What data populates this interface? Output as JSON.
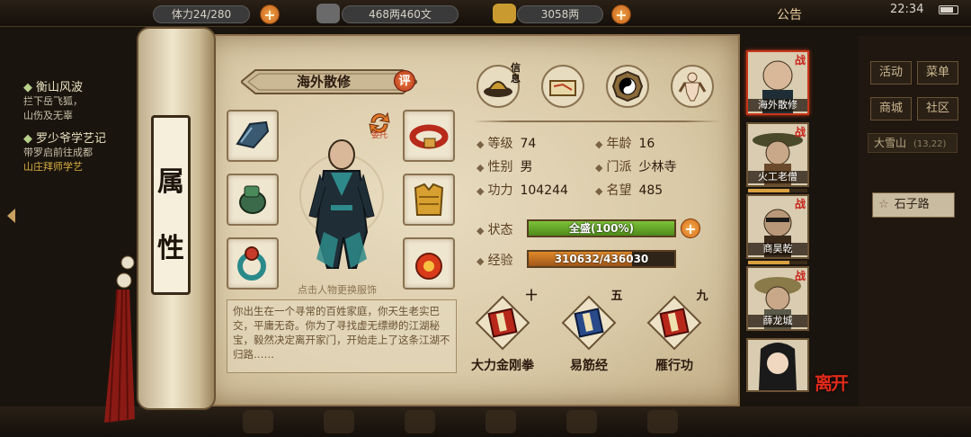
{
  "topbar": {
    "stamina": "体力24/280",
    "money": "468两460文",
    "gold": "3058两",
    "notice": "公告",
    "clock": "22:34"
  },
  "quests": [
    {
      "title": "衡山风波",
      "lines": [
        "拦下岳飞狐，",
        "山伤及无辜"
      ]
    },
    {
      "title": "罗少爷学艺记",
      "lines": [
        "带罗启前往成都",
        "山庄拜师学艺"
      ]
    }
  ],
  "side_menu": {
    "buttons": [
      "活动",
      "菜单",
      "商城",
      "社区"
    ],
    "region": "大雪山",
    "region_coords": "(13,22)",
    "location": "石子路"
  },
  "scroll": {
    "title_chars": [
      "属",
      "性"
    ],
    "name": "海外散修",
    "eval": "评",
    "delegate": "委托",
    "hero_hint": "点击人物更换服饰",
    "bio": "你出生在一个寻常的百姓家庭，你天生老实巴交，平庸无奇。你为了寻找虚无缥缈的江湖秘宝，毅然决定离开家门，开始走上了这条江湖不归路……",
    "info_tag": "信息"
  },
  "stats": {
    "level_label": "等级",
    "level": "74",
    "age_label": "年龄",
    "age": "16",
    "gender_label": "性别",
    "gender": "男",
    "sect_label": "门派",
    "sect": "少林寺",
    "power_label": "功力",
    "power": "104244",
    "fame_label": "名望",
    "fame": "485",
    "state_label": "状态",
    "state_text": "全盛(100%)",
    "state_pct": 100,
    "exp_label": "经验",
    "exp_text": "310632/436030",
    "exp_pct": 71.2
  },
  "skills": [
    {
      "level": "十",
      "name": "大力金刚拳"
    },
    {
      "level": "五",
      "name": "易筋经"
    },
    {
      "level": "九",
      "name": "雁行功"
    }
  ],
  "party": [
    {
      "name": "海外散修",
      "tag": "战",
      "active": true
    },
    {
      "name": "火工老僧",
      "tag": "战",
      "active": false
    },
    {
      "name": "商昊乾",
      "tag": "战",
      "active": false
    },
    {
      "name": "薛龙城",
      "tag": "战",
      "active": false
    },
    {
      "name": "",
      "tag": "",
      "active": false
    }
  ],
  "leave": "离开",
  "colors": {
    "state_fill": "#7cc23a",
    "exp_fill": "#e08a2a",
    "war_tag": "#c8231a",
    "leave": "#e02a1a"
  }
}
